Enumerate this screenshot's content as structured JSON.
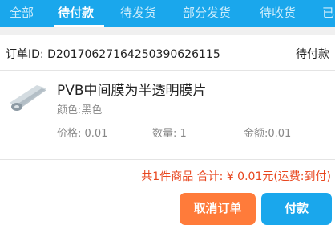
{
  "tabs": [
    {
      "label": "全部"
    },
    {
      "label": "待付款"
    },
    {
      "label": "待发货"
    },
    {
      "label": "部分发货"
    },
    {
      "label": "待收货"
    },
    {
      "label": "已"
    }
  ],
  "order": {
    "id_text": "订单ID: D20170627164250390626115",
    "status": "待付款"
  },
  "product": {
    "name": "PVB中间膜为半透明膜片",
    "color": "颜色:黑色",
    "price": "价格: 0.01",
    "quantity": "数量: 1",
    "amount": "金额:0.01"
  },
  "summary": "共1件商品 合计: ¥ 0.01元(运费:到付)",
  "buttons": {
    "cancel": "取消订单",
    "pay": "付款"
  },
  "colors": {
    "accent_blue": "#1aa7ec",
    "cancel_orange": "#ff7b3a",
    "summary_red": "#e8461e"
  },
  "active_tab": "待付款"
}
